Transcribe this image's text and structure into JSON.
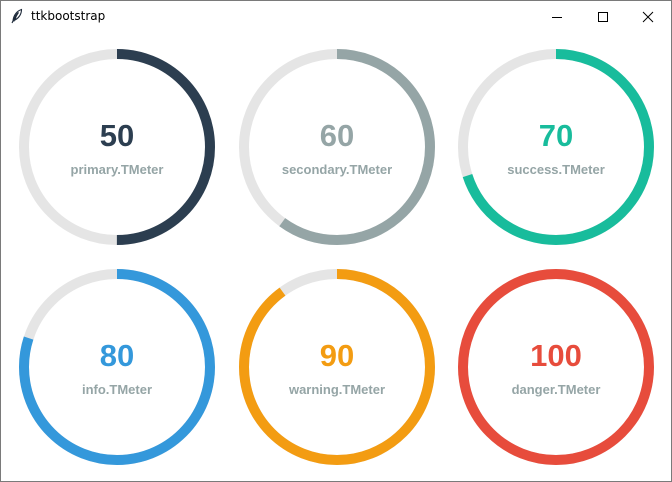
{
  "window": {
    "title": "ttkbootstrap",
    "app_icon": "feather-icon"
  },
  "title_buttons": {
    "minimize_icon": "minimize-icon",
    "maximize_icon": "maximize-icon",
    "close_icon": "close-icon"
  },
  "meters": [
    {
      "value": "50",
      "percent": 50,
      "label": "primary.TMeter",
      "color": "#2c3e50"
    },
    {
      "value": "60",
      "percent": 60,
      "label": "secondary.TMeter",
      "color": "#95a5a6"
    },
    {
      "value": "70",
      "percent": 70,
      "label": "success.TMeter",
      "color": "#18bc9c"
    },
    {
      "value": "80",
      "percent": 80,
      "label": "info.TMeter",
      "color": "#3498db"
    },
    {
      "value": "90",
      "percent": 90,
      "label": "warning.TMeter",
      "color": "#f39c12"
    },
    {
      "value": "100",
      "percent": 100,
      "label": "danger.TMeter",
      "color": "#e74c3c"
    }
  ],
  "colors": {
    "trough": "#e5e5e5",
    "label": "#95a5a6"
  }
}
